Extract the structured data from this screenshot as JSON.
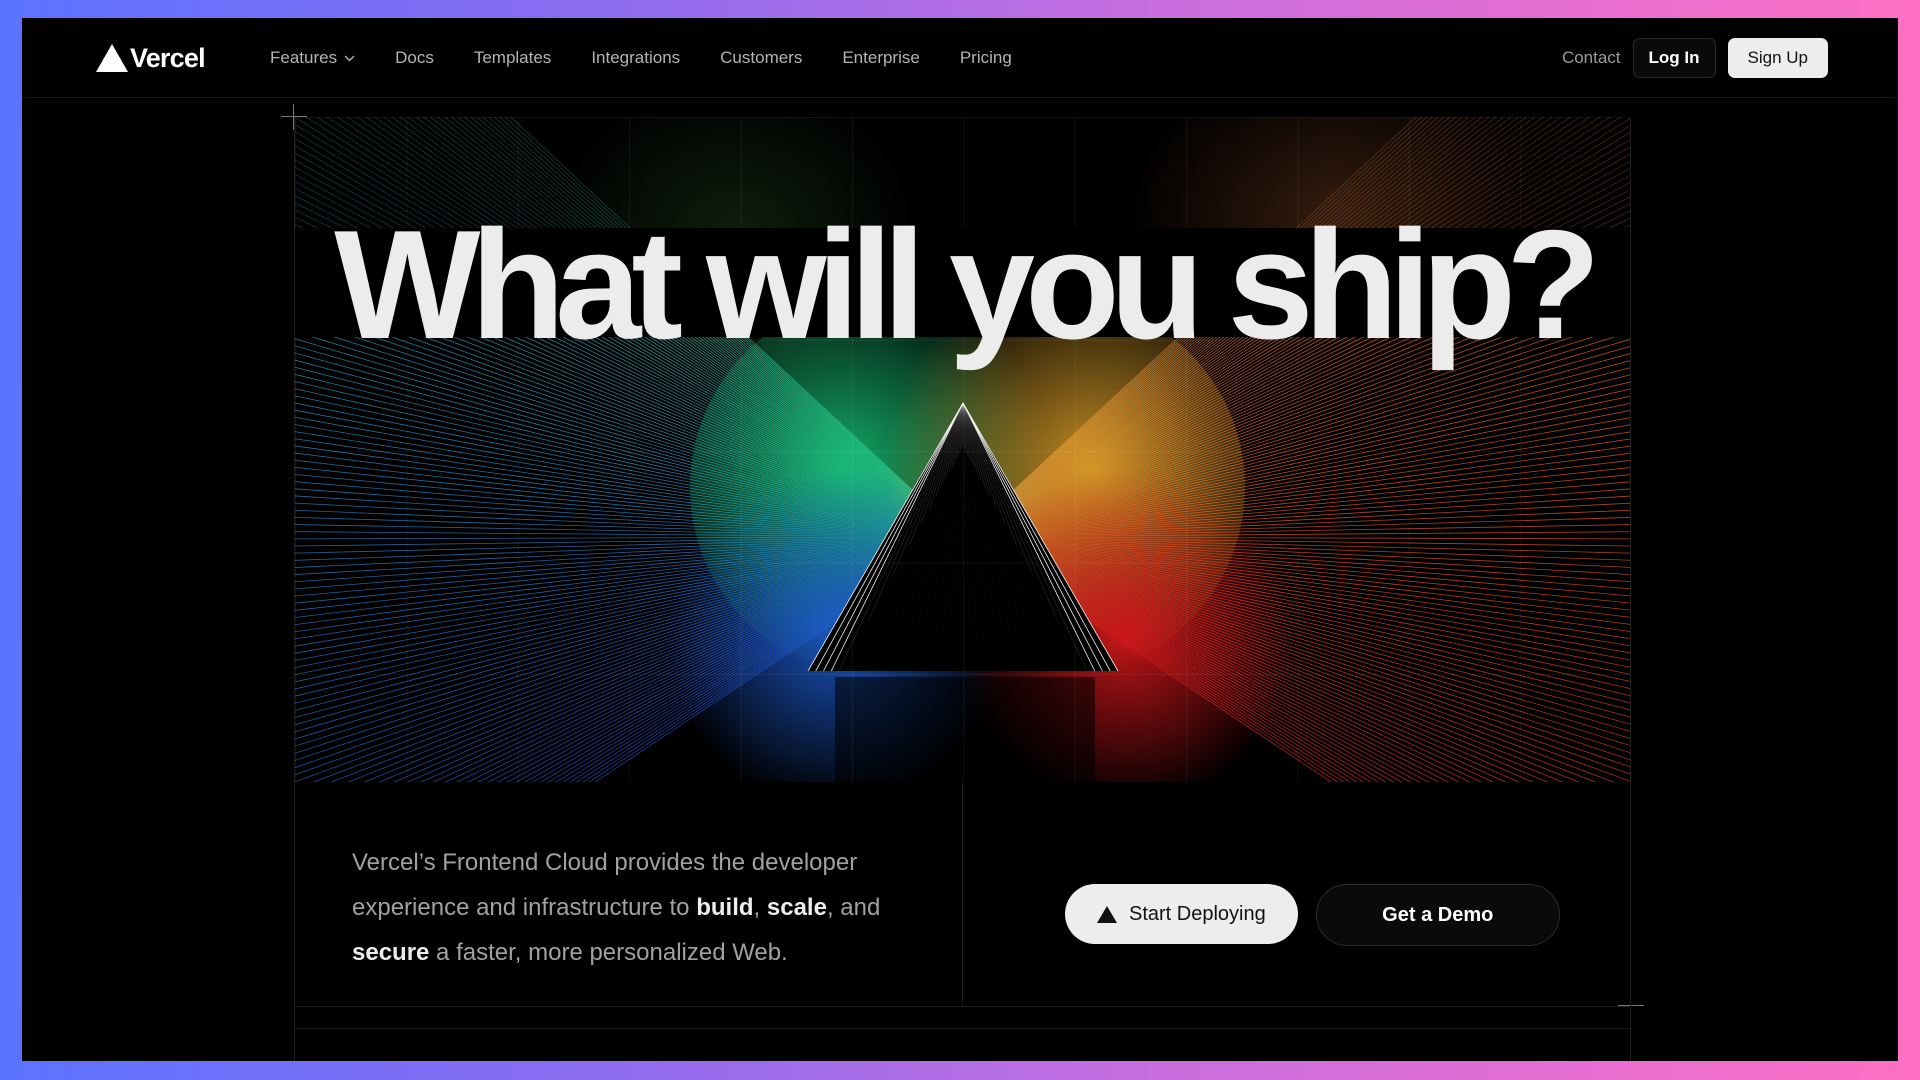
{
  "brand": {
    "name": "Vercel"
  },
  "nav": {
    "items": [
      {
        "label": "Features",
        "has_dropdown": true
      },
      {
        "label": "Docs"
      },
      {
        "label": "Templates"
      },
      {
        "label": "Integrations"
      },
      {
        "label": "Customers"
      },
      {
        "label": "Enterprise"
      },
      {
        "label": "Pricing"
      }
    ],
    "contact": "Contact",
    "login": "Log In",
    "signup": "Sign Up"
  },
  "hero": {
    "headline": "What will you ship?"
  },
  "intro": {
    "p1": "Vercel’s Frontend Cloud provides the developer experience and infrastructure to ",
    "build": "build",
    "sep1": ", ",
    "scale": "scale",
    "p2": ", and ",
    "secure": "secure",
    "p3": " a faster, more personalized Web."
  },
  "cta": {
    "deploy": "Start Deploying",
    "demo": "Get a Demo"
  },
  "colors": {
    "background": "#000000",
    "frame_gradient_left": "#5b73ff",
    "frame_gradient_right": "#ff6fc4",
    "text_primary": "#ededed",
    "text_muted": "#a1a1a1",
    "spectrum_green": "#1fc77a",
    "spectrum_blue": "#1e64d6",
    "spectrum_orange": "#e08a2a",
    "spectrum_red": "#d11a1a"
  },
  "icons": {
    "logo": "triangle-logo-icon",
    "dropdown": "chevron-down-icon",
    "deploy": "triangle-icon"
  }
}
